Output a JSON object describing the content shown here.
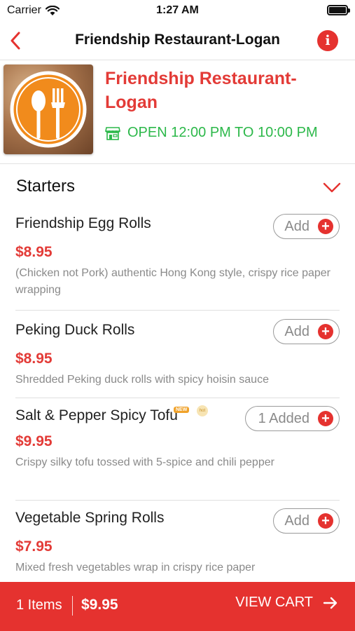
{
  "status_bar": {
    "carrier": "Carrier",
    "time": "1:27 AM"
  },
  "nav": {
    "title": "Friendship Restaurant-Logan",
    "info_glyph": "i"
  },
  "restaurant": {
    "name": "Friendship Restaurant-Logan",
    "hours": "OPEN 12:00 PM TO 10:00 PM"
  },
  "section": {
    "title": "Starters"
  },
  "items": [
    {
      "name": "Friendship Egg Rolls",
      "price": "$8.95",
      "description": "(Chicken not Pork) authentic Hong Kong style, crispy rice paper wrapping",
      "button": "Add"
    },
    {
      "name": "Peking Duck Rolls",
      "price": "$8.95",
      "description": "Shredded Peking duck rolls with spicy hoisin sauce",
      "button": "Add"
    },
    {
      "name": "Salt & Pepper Spicy Tofu",
      "price": "$9.95",
      "description": "Crispy silky tofu tossed with 5-spice and chili pepper",
      "button": "1 Added",
      "badge_new": "NEW",
      "badge_hot": "hot"
    },
    {
      "name": "Vegetable Spring Rolls",
      "price": "$7.95",
      "description": "Mixed fresh vegetables wrap in crispy rice paper",
      "button": "Add"
    }
  ],
  "cart": {
    "count": "1 Items",
    "total": "$9.95",
    "view_label": "VIEW CART"
  },
  "colors": {
    "accent": "#e5322f",
    "open": "#2cb84a"
  }
}
